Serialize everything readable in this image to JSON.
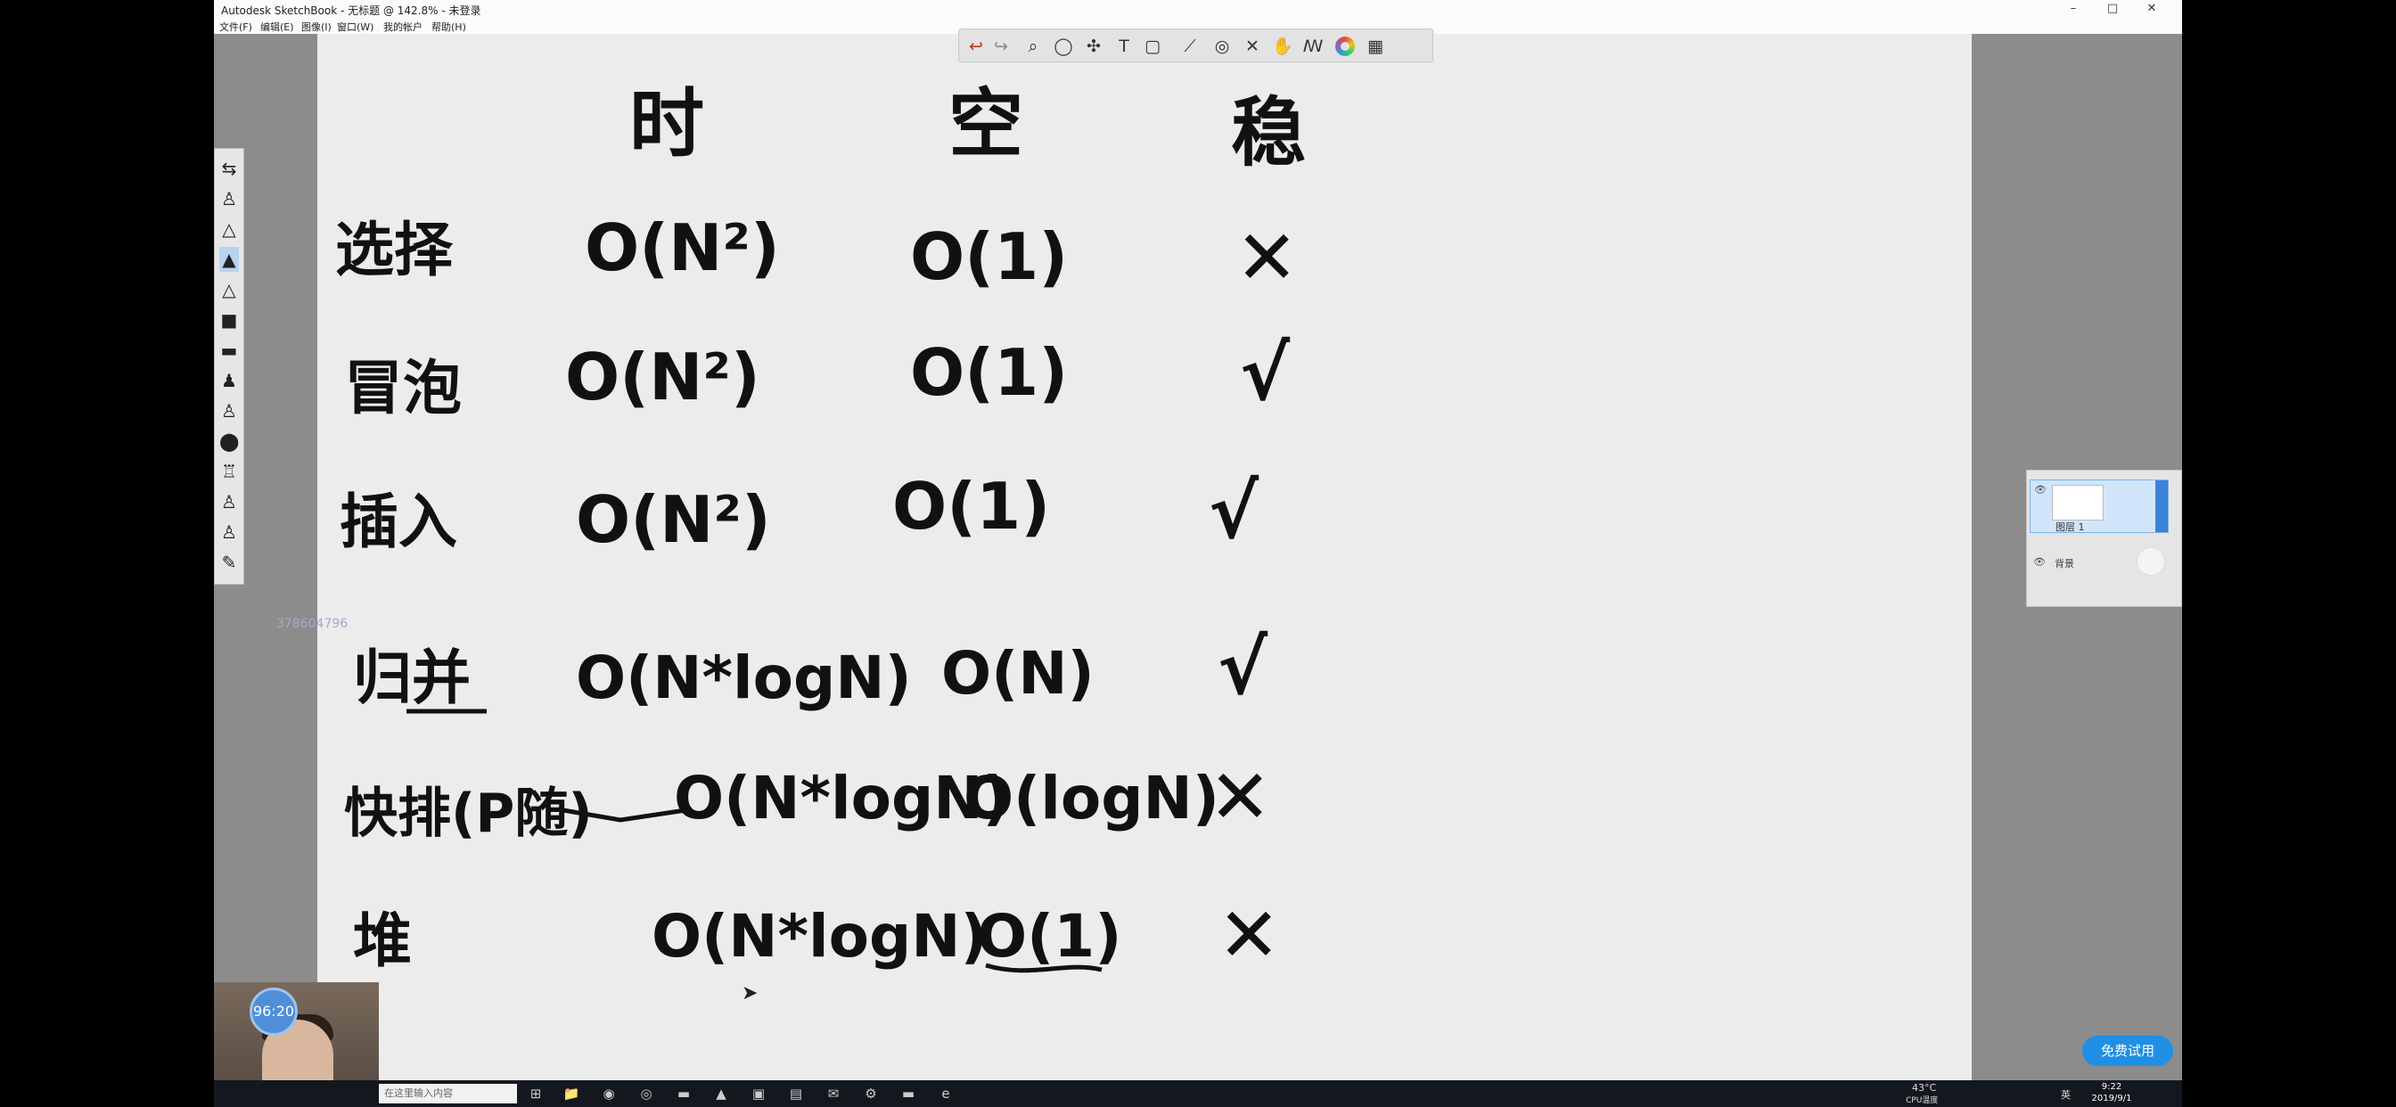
{
  "window": {
    "title": "Autodesk SketchBook - 无标题 @ 142.8% - 未登录",
    "controls": [
      "–",
      "□",
      "✕"
    ]
  },
  "menu": [
    "文件(F)",
    "编辑(E)",
    "图像(I)",
    "窗口(W)",
    "我的帐户",
    "帮助(H)"
  ],
  "toolbar": {
    "icons": [
      "undo-icon",
      "redo-icon",
      "zoom-icon",
      "lasso-icon",
      "move-icon",
      "text-icon",
      "layer-icon",
      "ruler-icon",
      "symmetry-icon",
      "distort-icon",
      "hand-icon",
      "brush-library-icon",
      "color-wheel-icon",
      "copic-icon"
    ],
    "glyphs": [
      "↩",
      "↪",
      "⌕",
      "◯",
      "✣",
      "T",
      "▢",
      "⟋",
      "◎",
      "✕",
      "✋",
      "ꟿ",
      "",
      "▦"
    ]
  },
  "palette": {
    "glyphs": [
      "⇆",
      "♙",
      "△",
      "▲",
      "△",
      "■",
      "▬",
      "♟",
      "♙",
      "⬤",
      "♖",
      "♙",
      "♙",
      "✎"
    ],
    "selected_index": 3
  },
  "user_id": "378604796",
  "board": {
    "headers": [
      "时",
      "空",
      "稳"
    ],
    "rows": [
      {
        "name": "选择",
        "time": "O(N²)",
        "space": "O(1)",
        "stable": "✕"
      },
      {
        "name": "冒泡",
        "time": "O(N²)",
        "space": "O(1)",
        "stable": "√"
      },
      {
        "name": "插入",
        "time": "O(N²)",
        "space": "O(1)",
        "stable": "√"
      },
      {
        "name": "归并",
        "time": "O(N*logN)",
        "space": "O(N)",
        "stable": "√"
      },
      {
        "name": "快排(P随)",
        "time": "O(N*logN)",
        "space": "O(logN)",
        "stable": "✕"
      },
      {
        "name": "堆",
        "time": "O(N*logN)",
        "space": "O(1)",
        "stable": "✕"
      }
    ]
  },
  "layers": {
    "layer1_name": "图层 1",
    "layer2_name": "背景"
  },
  "trial_button": "免费试用",
  "webcam": {
    "timer": "96:20"
  },
  "taskbar": {
    "search": "在这里输入内容",
    "apps": [
      "⊞",
      "▣",
      "📁",
      "◉",
      "◎",
      "▬",
      "▲",
      "▣",
      "▤",
      "✉",
      "⚙",
      "▬",
      "e"
    ],
    "tray": {
      "temp": "43°C",
      "cpu_label": "CPU温度",
      "lang": "英",
      "time": "9:22",
      "date": "2019/9/1"
    }
  }
}
